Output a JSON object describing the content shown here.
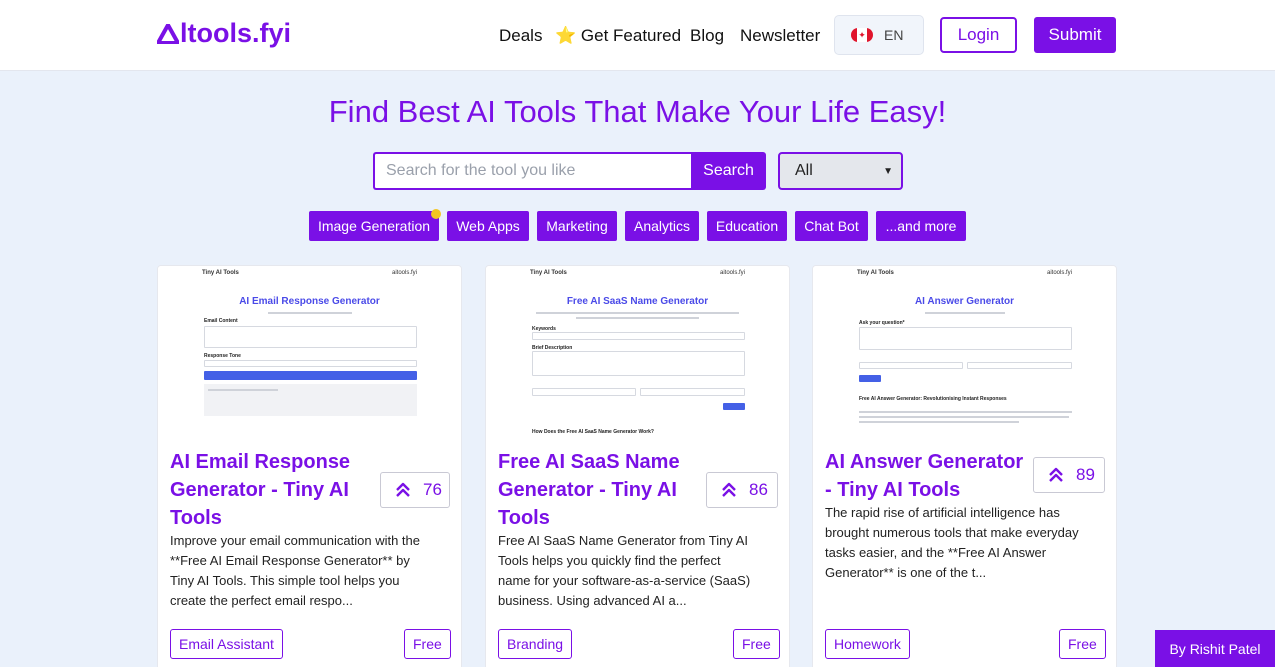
{
  "brand": {
    "name": "AItools.fyi",
    "text": "ltools.fyi",
    "color": "#7a10e6"
  },
  "nav": {
    "deals": "Deals",
    "featured_star": "⭐",
    "featured": "Get Featured",
    "blog": "Blog",
    "newsletter": "Newsletter",
    "lang": "EN",
    "login": "Login",
    "submit": "Submit"
  },
  "hero": {
    "title": "Find Best AI Tools That Make Your Life Easy!"
  },
  "search": {
    "placeholder": "Search for the tool you like",
    "button": "Search",
    "category": "All"
  },
  "categories": [
    "Image Generation",
    "Web Apps",
    "Marketing",
    "Analytics",
    "Education",
    "Chat Bot",
    "...and more"
  ],
  "cards": [
    {
      "title_lines": [
        "AI Email Response",
        "Generator - Tiny AI",
        "Tools"
      ],
      "votes": "76",
      "desc_lines": [
        "Improve your email communication with the",
        "**Free AI Email Response Generator** by",
        "Tiny AI Tools. This simple tool helps you",
        "create the perfect email respo..."
      ],
      "tag": "Email Assistant",
      "pricing": "Free",
      "shot": {
        "site": "Tiny AI Tools",
        "domain": "aitools.fyi",
        "heading": "AI Email Response Generator"
      }
    },
    {
      "title_lines": [
        "Free AI SaaS Name",
        "Generator - Tiny AI",
        "Tools"
      ],
      "votes": "86",
      "desc_lines": [
        "Free AI SaaS Name Generator from Tiny AI",
        "Tools helps you quickly find the perfect",
        "name for your software-as-a-service (SaaS)",
        "business. Using advanced AI a..."
      ],
      "tag": "Branding",
      "pricing": "Free",
      "shot": {
        "site": "Tiny AI Tools",
        "domain": "aitools.fyi",
        "heading": "Free AI SaaS Name Generator",
        "footer": "How Does the Free AI SaaS Name Generator Work?"
      }
    },
    {
      "title_lines": [
        "AI Answer Generator",
        "- Tiny AI Tools"
      ],
      "votes": "89",
      "desc_lines": [
        "The rapid rise of artificial intelligence has",
        "brought numerous tools that make everyday",
        "tasks easier, and the **Free AI Answer",
        "Generator** is one of the t..."
      ],
      "tag": "Homework",
      "pricing": "Free",
      "shot": {
        "site": "Tiny AI Tools",
        "domain": "aitools.fyi",
        "heading": "AI Answer Generator",
        "subheading": "Free AI Answer Generator: Revolutionising Instant Responses"
      }
    }
  ],
  "byline": "By Rishit Patel"
}
